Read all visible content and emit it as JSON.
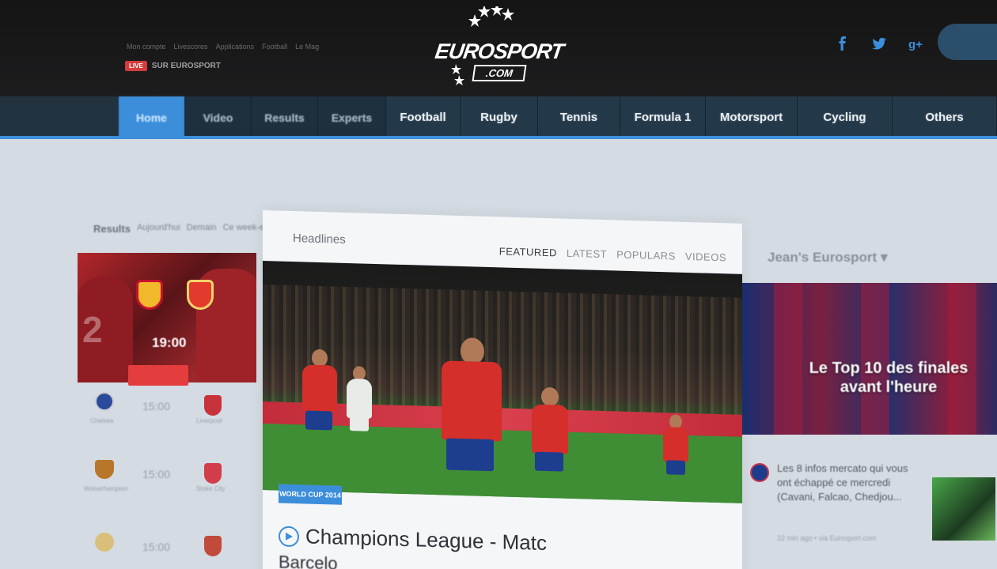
{
  "header": {
    "top_links": [
      "Mon compte",
      "Livescores",
      "Applications",
      "Football",
      "Le Mag"
    ],
    "live_badge": "LIVE",
    "live_text": "SUR EUROSPORT",
    "logo_top": "EUROSPORT",
    "logo_bottom": ".COM",
    "social_icons": [
      "facebook-icon",
      "twitter-icon",
      "google-plus-icon"
    ]
  },
  "nav": {
    "items": [
      {
        "label": "Home",
        "active": true
      },
      {
        "label": "Video"
      },
      {
        "label": "Results"
      },
      {
        "label": "Experts"
      },
      {
        "label": "Football"
      },
      {
        "label": "Rugby"
      },
      {
        "label": "Tennis"
      },
      {
        "label": "Formula 1"
      },
      {
        "label": "Motorsport"
      },
      {
        "label": "Cycling"
      },
      {
        "label": "Others"
      }
    ]
  },
  "left": {
    "results_title": "Results",
    "results_tabs": [
      "Aujourd'hui",
      "Demain",
      "Ce week-end"
    ],
    "match_time": "19:00",
    "fixtures": [
      {
        "time": "15:00",
        "home": "Chelsea",
        "away": "Liverpool"
      },
      {
        "time": "15:00",
        "home": "Wolverhampton",
        "away": "Stoke City"
      },
      {
        "time": "15:00",
        "home": "",
        "away": ""
      }
    ]
  },
  "center": {
    "section_title": "Headlines",
    "tabs": [
      "FEATURED",
      "LATEST",
      "POPULARS",
      "VIDEOS"
    ],
    "badge": "WORLD CUP 2014",
    "article_title": "Champions League - Matc",
    "article_subtitle": "Barcelo"
  },
  "right": {
    "title": "Jean's Eurosport",
    "card_text": "Le Top 10 des finales avant l'heure",
    "news_text": "Les 8 infos mercato qui vous ont échappé ce mercredi (Cavani, Falcao, Chedjou...",
    "news_meta": "22 min ago • via Eurosport.com"
  },
  "colors": {
    "accent": "#3c8edb",
    "header_bg": "#161616",
    "nav_bg": "#1e2f3d",
    "live_red": "#d23c3c"
  }
}
